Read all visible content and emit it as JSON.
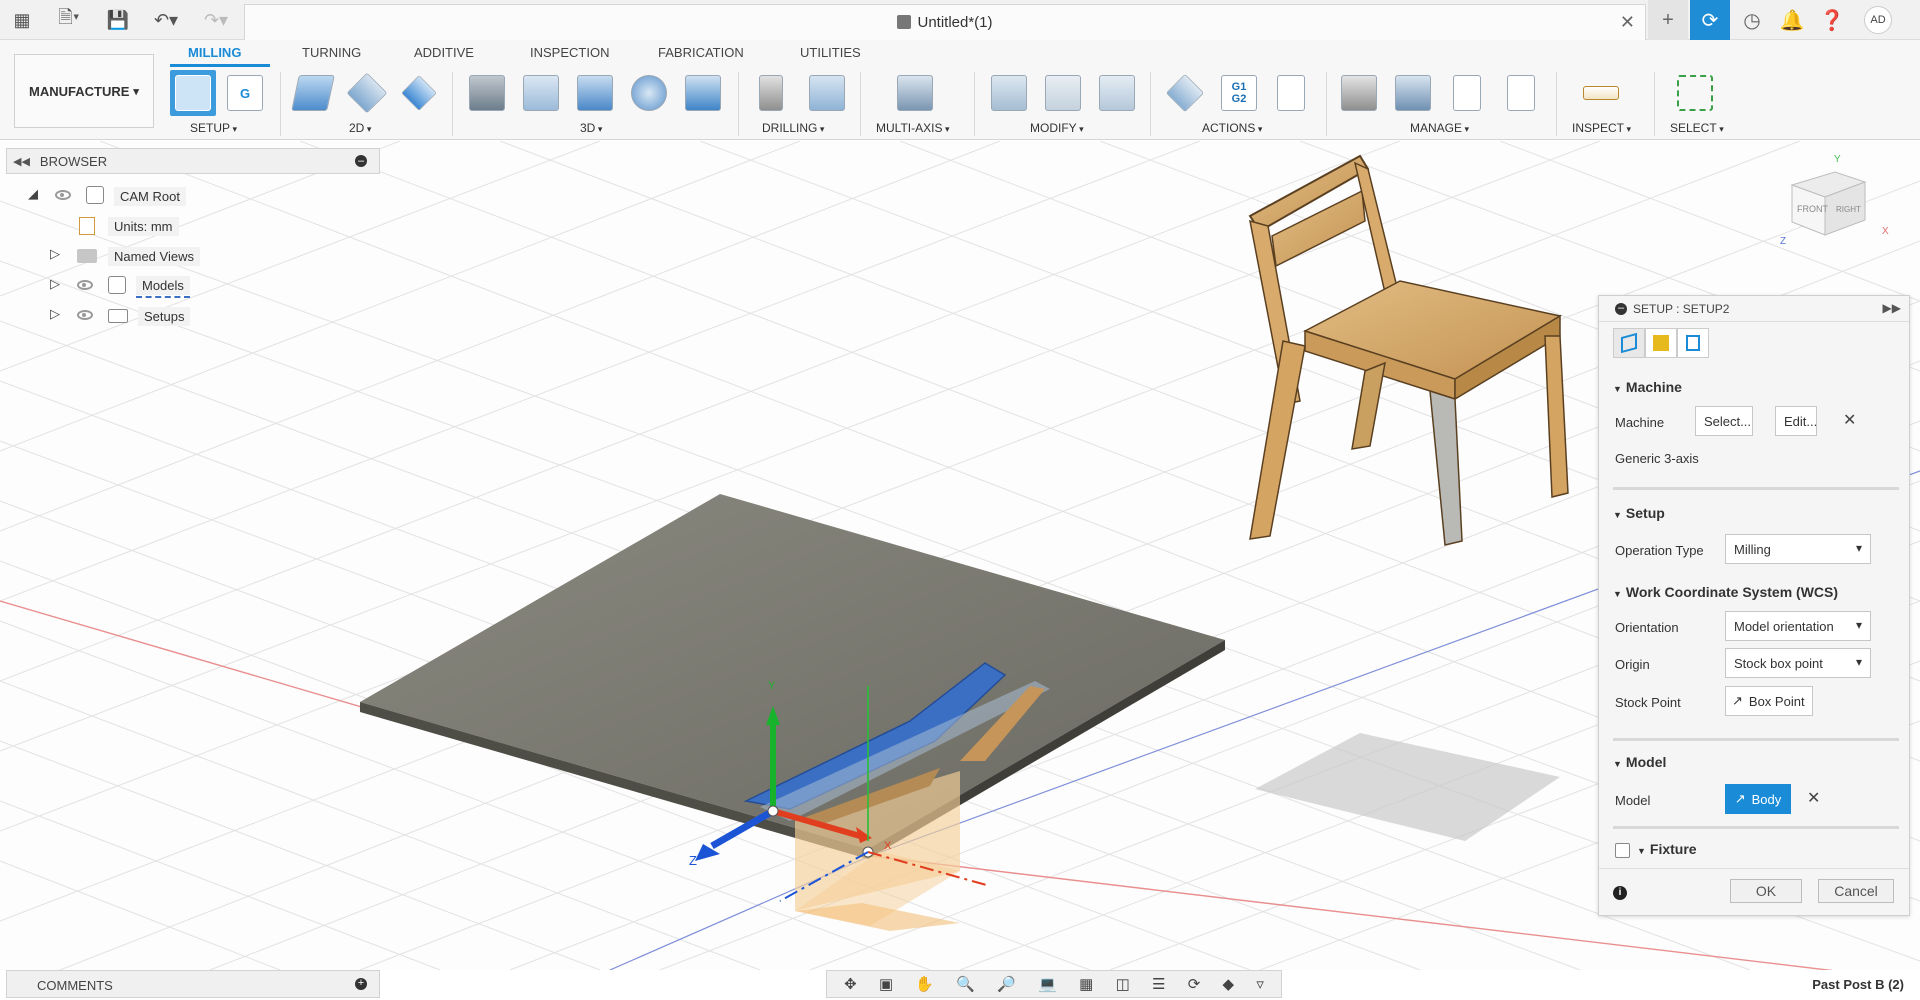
{
  "app": {
    "document_title": "Untitled*(1)",
    "user_initials": "AD"
  },
  "ribbon": {
    "workspace": "MANUFACTURE",
    "tabs": [
      "MILLING",
      "TURNING",
      "ADDITIVE",
      "INSPECTION",
      "FABRICATION",
      "UTILITIES"
    ],
    "active_tab": "MILLING",
    "groups": [
      "SETUP",
      "2D",
      "3D",
      "DRILLING",
      "MULTI-AXIS",
      "MODIFY",
      "ACTIONS",
      "MANAGE",
      "INSPECT",
      "SELECT"
    ],
    "actions_g1g2": "G1\nG2"
  },
  "browser": {
    "title": "BROWSER",
    "items": [
      {
        "label": "CAM Root"
      },
      {
        "label": "Units: mm"
      },
      {
        "label": "Named Views"
      },
      {
        "label": "Models"
      },
      {
        "label": "Setups"
      }
    ]
  },
  "setup_dialog": {
    "title": "SETUP : SETUP2",
    "sections": {
      "machine": {
        "heading": "Machine",
        "machine_label": "Machine",
        "select_btn": "Select...",
        "edit_btn": "Edit...",
        "machine_name": "Generic 3-axis"
      },
      "setup": {
        "heading": "Setup",
        "operation_type_label": "Operation Type",
        "operation_type_value": "Milling"
      },
      "wcs": {
        "heading": "Work Coordinate System (WCS)",
        "orientation_label": "Orientation",
        "orientation_value": "Model orientation",
        "origin_label": "Origin",
        "origin_value": "Stock box point",
        "stock_point_label": "Stock Point",
        "stock_point_value": "Box Point"
      },
      "model": {
        "heading": "Model",
        "model_label": "Model",
        "model_value": "Body"
      },
      "fixture": {
        "heading": "Fixture",
        "checked": false
      }
    },
    "ok": "OK",
    "cancel": "Cancel"
  },
  "viewport": {
    "axis_labels": {
      "y": "Y",
      "z": "Z",
      "x": "X"
    },
    "viewcube": {
      "front": "FRONT",
      "right": "RIGHT",
      "y": "Y",
      "z": "Z",
      "x": "X"
    }
  },
  "bottom": {
    "comments": "COMMENTS",
    "post": "Past Post B (2)"
  },
  "colors": {
    "accent": "#1a8bd6",
    "stock": "#7c7b73",
    "chair_wood": "#d9ae70",
    "part_blue": "#3b6fc4"
  }
}
